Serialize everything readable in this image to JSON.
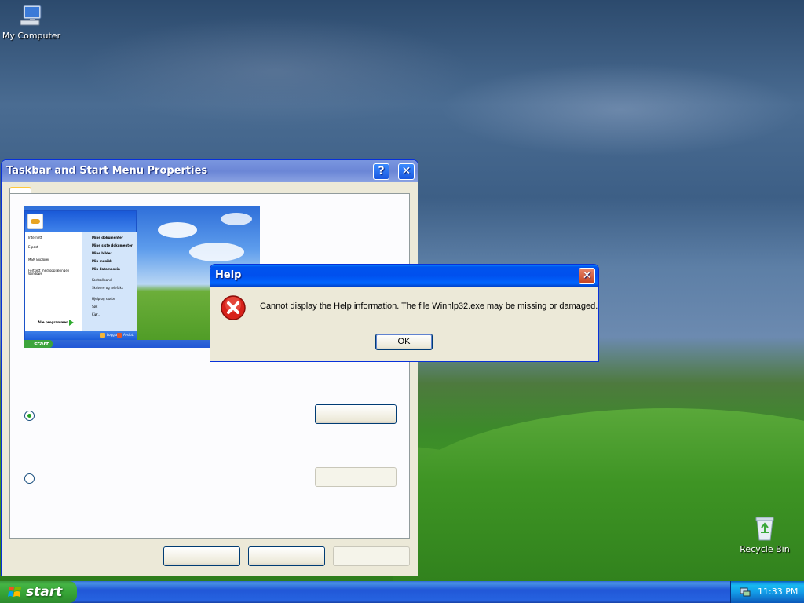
{
  "desktop": {
    "icons": [
      {
        "label": "My Computer"
      },
      {
        "label": "Recycle Bin"
      }
    ]
  },
  "taskbar_props_window": {
    "title": "Taskbar and Start Menu Properties",
    "help_btn": "?",
    "close_btn": "✕",
    "preview": {
      "start_label": "start",
      "left_items": [
        "Internett",
        "E-post",
        "MSN Explorer",
        "Fortsett med opplæringen i Windows"
      ],
      "all_programs": "Alle programmer",
      "right_items": [
        "Mine dokumenter",
        "Mine siste dokumenter",
        "Mine bilder",
        "Min musikk",
        "Min datamaskin",
        "Kontrollpanel",
        "Skrivere og telefaks",
        "Hjelp og støtte",
        "Søk",
        "Kjør..."
      ],
      "logoff": "Logg av",
      "turnoff": "Avslutt"
    }
  },
  "help_dialog": {
    "title": "Help",
    "close_btn": "✕",
    "message": "Cannot display the Help information. The file Winhlp32.exe may be missing or damaged.",
    "ok_label": "OK"
  },
  "taskbar": {
    "start_label": "start",
    "clock": "11:33 PM"
  }
}
